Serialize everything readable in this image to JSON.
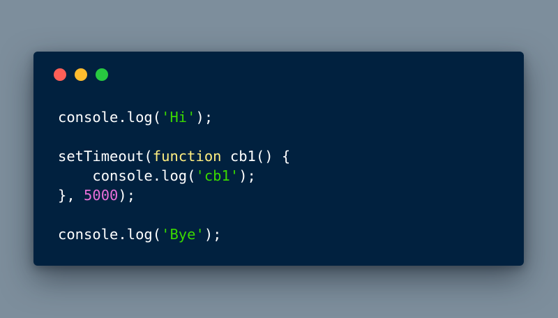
{
  "window": {
    "controls": [
      {
        "name": "close",
        "color": "#ff5f57"
      },
      {
        "name": "minimize",
        "color": "#febc2e"
      },
      {
        "name": "maximize",
        "color": "#28c840"
      }
    ]
  },
  "code": {
    "language": "javascript",
    "lines": [
      [
        {
          "text": "console.log(",
          "type": "plain"
        },
        {
          "text": "'Hi'",
          "type": "str"
        },
        {
          "text": ");",
          "type": "plain"
        }
      ],
      [],
      [
        {
          "text": "setTimeout(",
          "type": "plain"
        },
        {
          "text": "function",
          "type": "kw"
        },
        {
          "text": " cb1() {",
          "type": "plain"
        }
      ],
      [
        {
          "text": "    console.log(",
          "type": "plain"
        },
        {
          "text": "'cb1'",
          "type": "str"
        },
        {
          "text": ");",
          "type": "plain"
        }
      ],
      [
        {
          "text": "}, ",
          "type": "plain"
        },
        {
          "text": "5000",
          "type": "num"
        },
        {
          "text": ");",
          "type": "plain"
        }
      ],
      [],
      [
        {
          "text": "console.log(",
          "type": "plain"
        },
        {
          "text": "'Bye'",
          "type": "str"
        },
        {
          "text": ");",
          "type": "plain"
        }
      ]
    ]
  },
  "colors": {
    "background": "#7d8e9c",
    "window_bg": "#01213f",
    "plain": "#ffffff",
    "string": "#3ad900",
    "keyword": "#ffee80",
    "number": "#e86fd8"
  }
}
